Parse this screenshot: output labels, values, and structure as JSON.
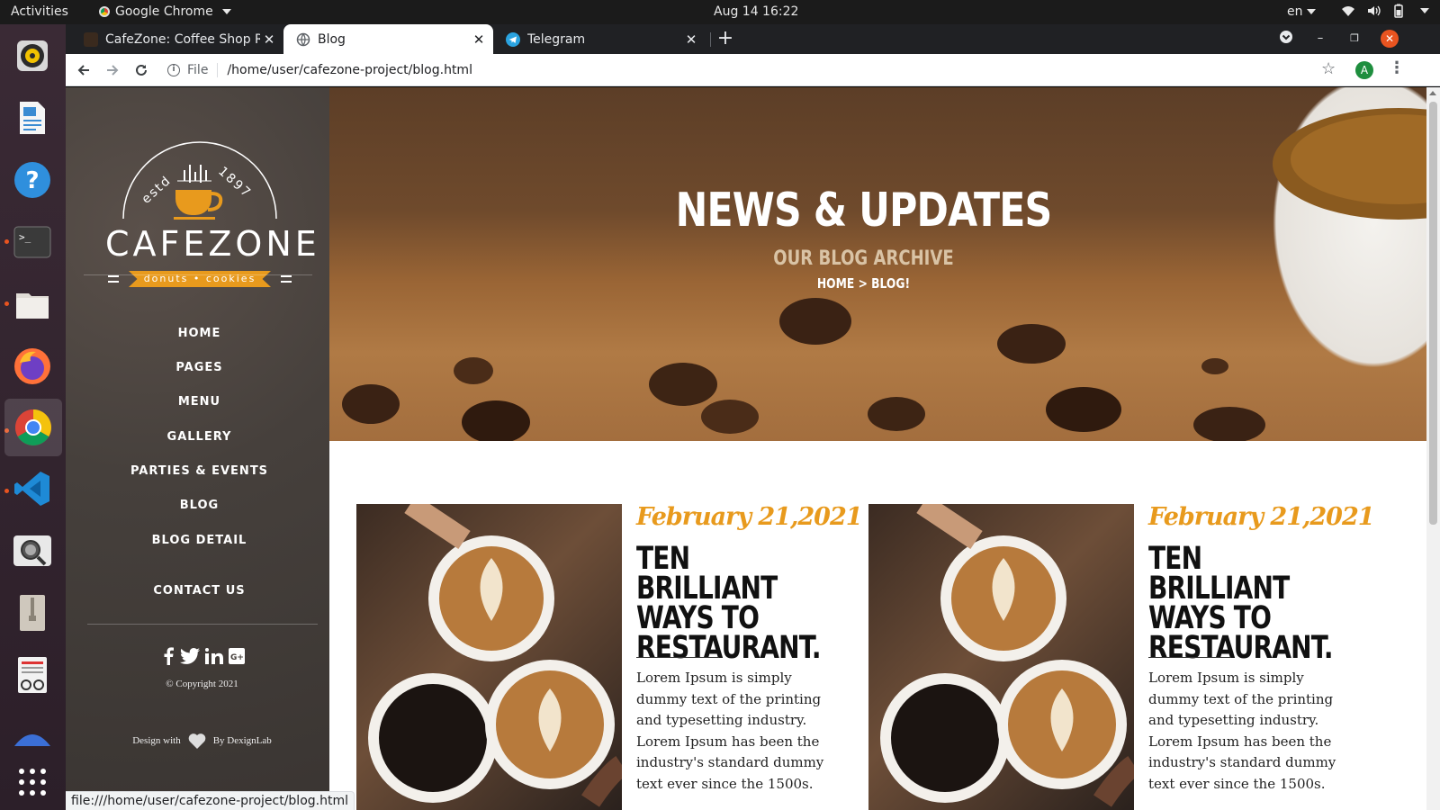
{
  "topbar": {
    "activities": "Activities",
    "app_name": "Google Chrome",
    "clock": "Aug 14  16:22",
    "lang": "en"
  },
  "dock": {
    "items": [
      {
        "name": "rhythmbox-icon"
      },
      {
        "name": "writer-icon"
      },
      {
        "name": "help-icon"
      },
      {
        "name": "terminal-icon"
      },
      {
        "name": "files-icon"
      },
      {
        "name": "firefox-icon"
      },
      {
        "name": "chrome-icon"
      },
      {
        "name": "vscode-icon"
      },
      {
        "name": "screenshot-icon"
      },
      {
        "name": "archive-icon"
      },
      {
        "name": "document-viewer-icon"
      },
      {
        "name": "partial-app-icon"
      },
      {
        "name": "show-apps-icon"
      }
    ]
  },
  "browser": {
    "tabs": [
      {
        "title": "CafeZone: Coffee Shop Re",
        "favicon": "cafezone-favicon"
      },
      {
        "title": "Blog",
        "favicon": "globe-icon"
      },
      {
        "title": "Telegram",
        "favicon": "telegram-icon"
      }
    ],
    "url_scheme": "File",
    "url": "/home/user/cafezone-project/blog.html",
    "profile_initial": "A",
    "status_url": "file:///home/user/cafezone-project/blog.html"
  },
  "site": {
    "logo": {
      "estd": "estd",
      "year": "1897",
      "name": "CAFEZONE",
      "tagline": "donuts • cookies"
    },
    "nav": [
      "HOME",
      "PAGES",
      "MENU",
      "GALLERY",
      "PARTIES & EVENTS",
      "BLOG",
      "BLOG DETAIL",
      "CONTACT US"
    ],
    "social": [
      "facebook-icon",
      "twitter-icon",
      "linkedin-icon",
      "google-plus-icon"
    ],
    "copyright": "© Copyright 2021",
    "designed_prefix": "Design with",
    "designed_suffix": "By DexignLab",
    "hero": {
      "title": "NEWS & UPDATES",
      "subtitle": "OUR BLOG ARCHIVE",
      "breadcrumb": "HOME > BLOG!"
    },
    "posts": [
      {
        "date": "February 21,2021",
        "title": "TEN BRILLIANT WAYS TO RESTAURANT.",
        "body": "Lorem Ipsum is simply dummy text of the printing and typesetting industry. Lorem Ipsum has been the industry's standard dummy text ever since the 1500s."
      },
      {
        "date": "February 21,2021",
        "title": "TEN BRILLIANT WAYS TO RESTAURANT.",
        "body": "Lorem Ipsum is simply dummy text of the printing and typesetting industry. Lorem Ipsum has been the industry's standard dummy text ever since the 1500s."
      }
    ]
  },
  "colors": {
    "accent": "#e89a1d",
    "sidebar": "#46403c",
    "topbar": "#1b1b1b",
    "tabstrip": "#202124"
  }
}
